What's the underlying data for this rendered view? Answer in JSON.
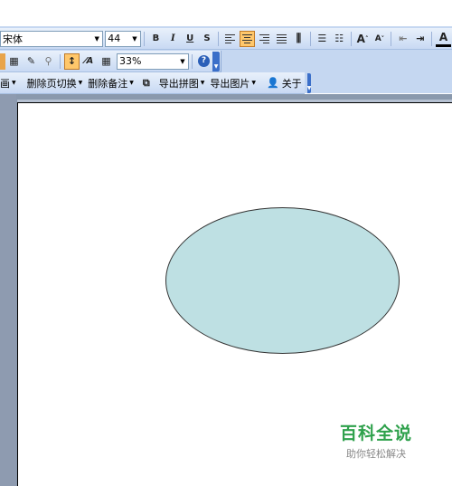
{
  "formatting": {
    "font_name": "宋体",
    "font_size": "44",
    "bold": "B",
    "italic": "I",
    "underline": "U",
    "shadow": "S",
    "grow_font": "A",
    "shrink_font": "A",
    "font_color": "A"
  },
  "standard": {
    "zoom": "33%"
  },
  "addin_toolbar": {
    "first_item_fragment": "画",
    "delete_transition": "删除页切换",
    "delete_notes": "删除备注",
    "export_puzzle": "导出拼图",
    "export_image": "导出图片",
    "about": "关于"
  },
  "watermark": {
    "title": "百科全说",
    "subtitle": "助你轻松解决"
  },
  "colors": {
    "ellipse_fill": "#bee0e3",
    "ellipse_border": "#333333",
    "watermark_green": "#2fa14c",
    "toolbar_bg": "#c5d7f1"
  }
}
